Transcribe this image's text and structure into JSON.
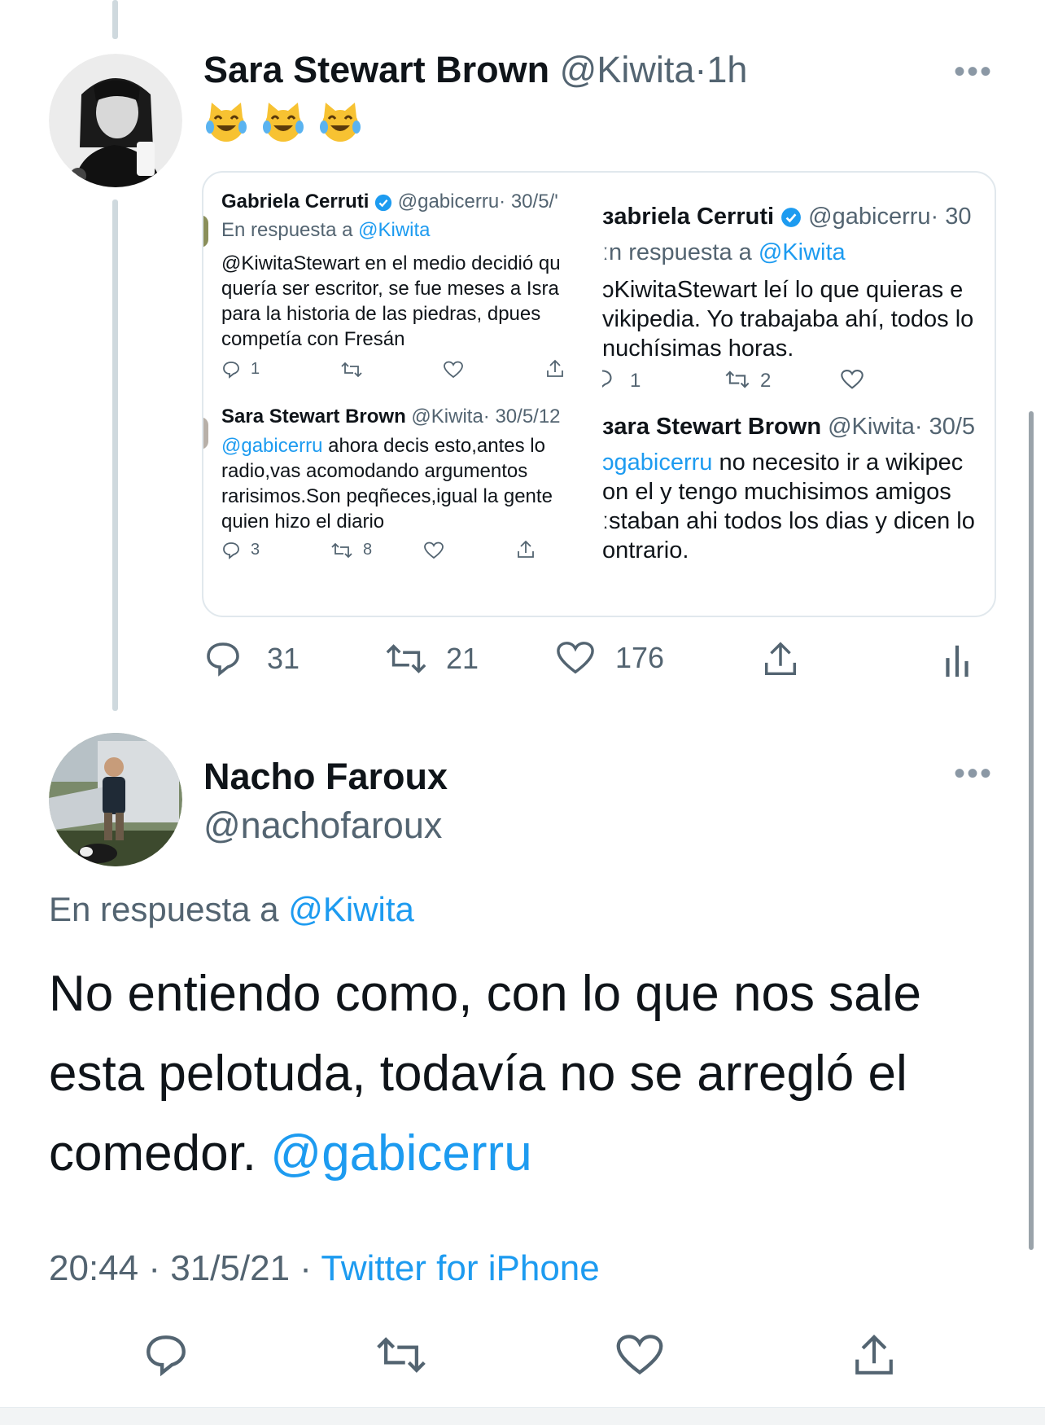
{
  "tweet1": {
    "name": "Sara Stewart Brown",
    "handle": "@Kiwita",
    "sep": "·",
    "time": "1h",
    "more": "•••",
    "emojis": [
      "cat-tears-of-joy",
      "cat-tears-of-joy",
      "cat-tears-of-joy"
    ],
    "actions": {
      "reply": "31",
      "retweet": "21",
      "like": "176"
    }
  },
  "quote": {
    "left": {
      "t1": {
        "name": "Gabriela Cerruti",
        "handle": "@gabicerru",
        "date": "· 30/5/'",
        "reply_prefix": "En respuesta a",
        "reply_link": "@Kiwita",
        "lines": [
          "@KiwitaStewart en el medio decidió qu",
          "quería ser escritor, se fue meses a Isra",
          "para la historia de las piedras, dpues",
          "competía con Fresán"
        ],
        "reply_count": "1"
      },
      "t2": {
        "name": "Sara Stewart Brown",
        "handle": "@Kiwita",
        "date": "· 30/5/12",
        "mention": "@gabicerru",
        "line1_rest": " ahora decis esto,antes lo",
        "lines": [
          "radio,vas acomodando argumentos",
          "rarisimos.Son peqñeces,igual la gente",
          "quien hizo el diario"
        ],
        "reply_count": "3",
        "retweet_count": "8"
      }
    },
    "right": {
      "t1": {
        "name": "ɜabriela Cerruti",
        "handle": "@gabicerru",
        "date": "· 30",
        "reply_prefix": "ːn respuesta a",
        "reply_link": "@Kiwita",
        "lines": [
          "ᴐKiwitaStewart  leí lo que quieras e",
          "vikipedia. Yo trabajaba ahí, todos lo",
          "nuchísimas horas."
        ],
        "reply_count": "1",
        "retweet_count": "2"
      },
      "t2": {
        "name": "ɜara Stewart Brown",
        "handle": "@Kiwita",
        "date": "· 30/5",
        "mention": "ᴐgabicerru",
        "line1_rest": " no necesito ir a wikipec",
        "lines": [
          "on el y tengo muchisimos amigos",
          "ːstaban ahi todos los dias y dicen lo",
          "ontrario."
        ]
      }
    }
  },
  "tweet2": {
    "name": "Nacho Faroux",
    "handle": "@nachofaroux",
    "more": "•••",
    "reply_prefix": "En respuesta a",
    "reply_link": "@Kiwita",
    "text_lines": [
      "No entiendo como, con lo que nos sale",
      "esta pelotuda, todavía no se arregló el",
      "comedor."
    ],
    "text_mention": "@gabicerru",
    "time": "20:44",
    "sep": "·",
    "date": "31/5/21",
    "source": "Twitter for iPhone"
  },
  "colors": {
    "link": "#1d9bf0",
    "text": "#0f1419",
    "secondary": "#536471",
    "border": "#e1e8ed",
    "verified": "#1d9bf0"
  }
}
